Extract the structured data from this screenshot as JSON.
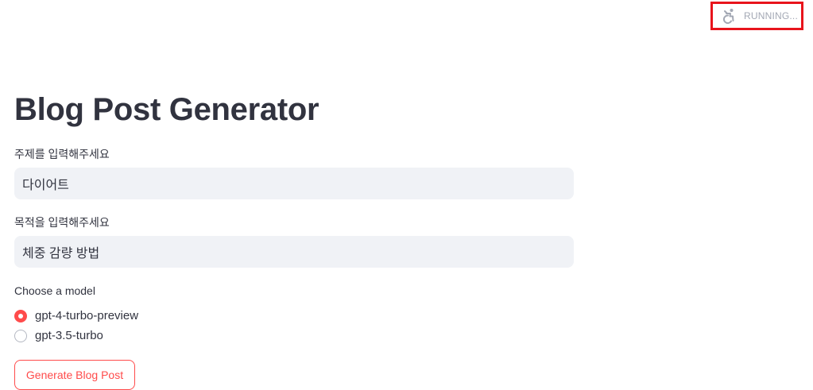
{
  "status": {
    "icon": "accessibility-running-icon",
    "text": "RUNNING..."
  },
  "page": {
    "title": "Blog Post Generator"
  },
  "form": {
    "topic": {
      "label": "주제를 입력해주세요",
      "value": "다이어트"
    },
    "purpose": {
      "label": "목적을 입력해주세요",
      "value": "체중 감량 방법"
    },
    "model": {
      "label": "Choose a model",
      "options": [
        {
          "label": "gpt-4-turbo-preview",
          "selected": true
        },
        {
          "label": "gpt-3.5-turbo",
          "selected": false
        }
      ]
    },
    "submit_label": "Generate Blog Post"
  },
  "colors": {
    "accent": "#ff4b4b",
    "status_highlight": "#e8141c",
    "input_background": "#f0f2f6",
    "text": "#31333f"
  }
}
